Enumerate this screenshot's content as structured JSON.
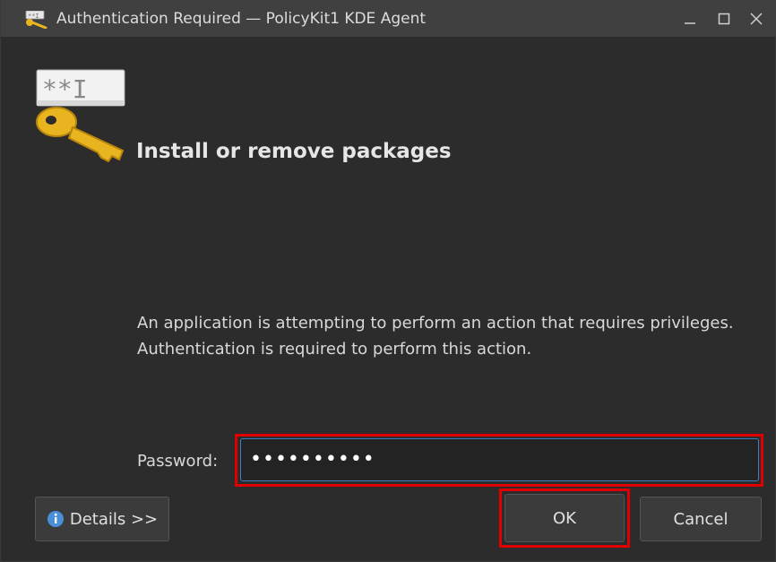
{
  "window": {
    "title": "Authentication Required — PolicyKit1 KDE Agent",
    "app_icon": "policykit-icon",
    "controls": {
      "minimize_icon": "minimize-icon",
      "maximize_icon": "maximize-icon",
      "close_icon": "close-icon"
    }
  },
  "header": {
    "icon": "password-key-icon",
    "icon_text": "**I",
    "action_title": "Install or remove packages"
  },
  "body": {
    "description": "An application is attempting to perform an action that requires privileges. Authentication is required to perform this action."
  },
  "password": {
    "label": "Password:",
    "value": "••••••••••"
  },
  "buttons": {
    "details_label": "Details >>",
    "details_icon": "info-icon",
    "ok_label": "OK",
    "cancel_label": "Cancel"
  },
  "colors": {
    "background": "#2c2c2c",
    "titlebar": "#404040",
    "highlight": "#e00000",
    "focus_border": "#3d7fc1",
    "info_icon": "#4a90d9",
    "key": "#e8b420"
  }
}
